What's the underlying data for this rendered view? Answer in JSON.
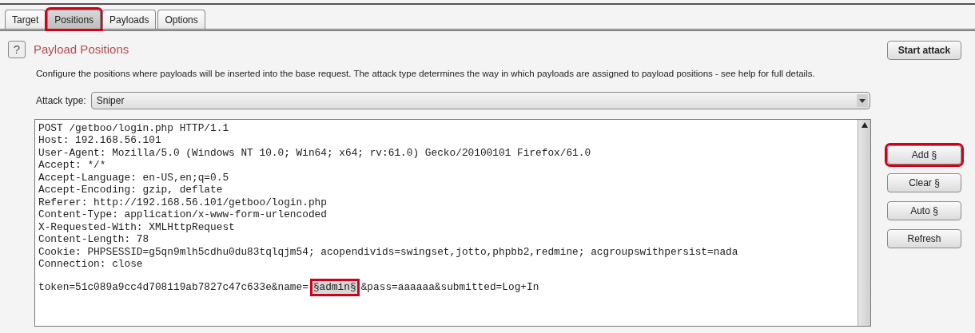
{
  "tabs": [
    {
      "label": "Target",
      "selected": false,
      "highlighted": false
    },
    {
      "label": "Positions",
      "selected": true,
      "highlighted": true
    },
    {
      "label": "Payloads",
      "selected": false,
      "highlighted": false
    },
    {
      "label": "Options",
      "selected": false,
      "highlighted": false
    }
  ],
  "help_icon": "?",
  "title": "Payload Positions",
  "description": "Configure the positions where payloads will be inserted into the base request. The attack type determines the way in which payloads are assigned to payload positions - see help for full details.",
  "attack_type": {
    "label": "Attack type:",
    "value": "Sniper"
  },
  "start_button": {
    "label": "Start attack",
    "highlighted": false
  },
  "request_lines": [
    [
      {
        "kind": "plain",
        "text": "POST /getboo/login.php HTTP/1.1"
      }
    ],
    [
      {
        "kind": "plain",
        "text": "Host: 192.168.56.101"
      }
    ],
    [
      {
        "kind": "plain",
        "text": "User-Agent: Mozilla/5.0 (Windows NT 10.0; Win64; x64; rv:61.0) Gecko/20100101 Firefox/61.0"
      }
    ],
    [
      {
        "kind": "plain",
        "text": "Accept: */*"
      }
    ],
    [
      {
        "kind": "plain",
        "text": "Accept-Language: en-US,en;q=0.5"
      }
    ],
    [
      {
        "kind": "plain",
        "text": "Accept-Encoding: gzip, deflate"
      }
    ],
    [
      {
        "kind": "plain",
        "text": "Referer: http://192.168.56.101/getboo/login.php"
      }
    ],
    [
      {
        "kind": "plain",
        "text": "Content-Type: application/x-www-form-urlencoded"
      }
    ],
    [
      {
        "kind": "plain",
        "text": "X-Requested-With: XMLHttpRequest"
      }
    ],
    [
      {
        "kind": "plain",
        "text": "Content-Length: 78"
      }
    ],
    [
      {
        "kind": "plain",
        "text": "Cookie: PHPSESSID=g5qn9mlh5cdhu0du83tqlqjm54; acopendivids=swingset,jotto,phpbb2,redmine; acgroupswithpersist=nada"
      }
    ],
    [
      {
        "kind": "plain",
        "text": "Connection: close"
      }
    ],
    {
      "kind": "body",
      "segments": [
        {
          "kind": "plain",
          "text": "token=51c089a9cc4d708119ab7827c47c633e&name="
        },
        {
          "kind": "payload",
          "text": "§admin§",
          "highlighted": true
        },
        {
          "kind": "plain",
          "text": "&pass=aaaaaa&submitted=Log+In"
        }
      ]
    }
  ],
  "side_buttons": [
    {
      "label": "Add §",
      "highlighted": true
    },
    {
      "label": "Clear §",
      "highlighted": false
    },
    {
      "label": "Auto §",
      "highlighted": false
    },
    {
      "label": "Refresh",
      "highlighted": false
    }
  ]
}
